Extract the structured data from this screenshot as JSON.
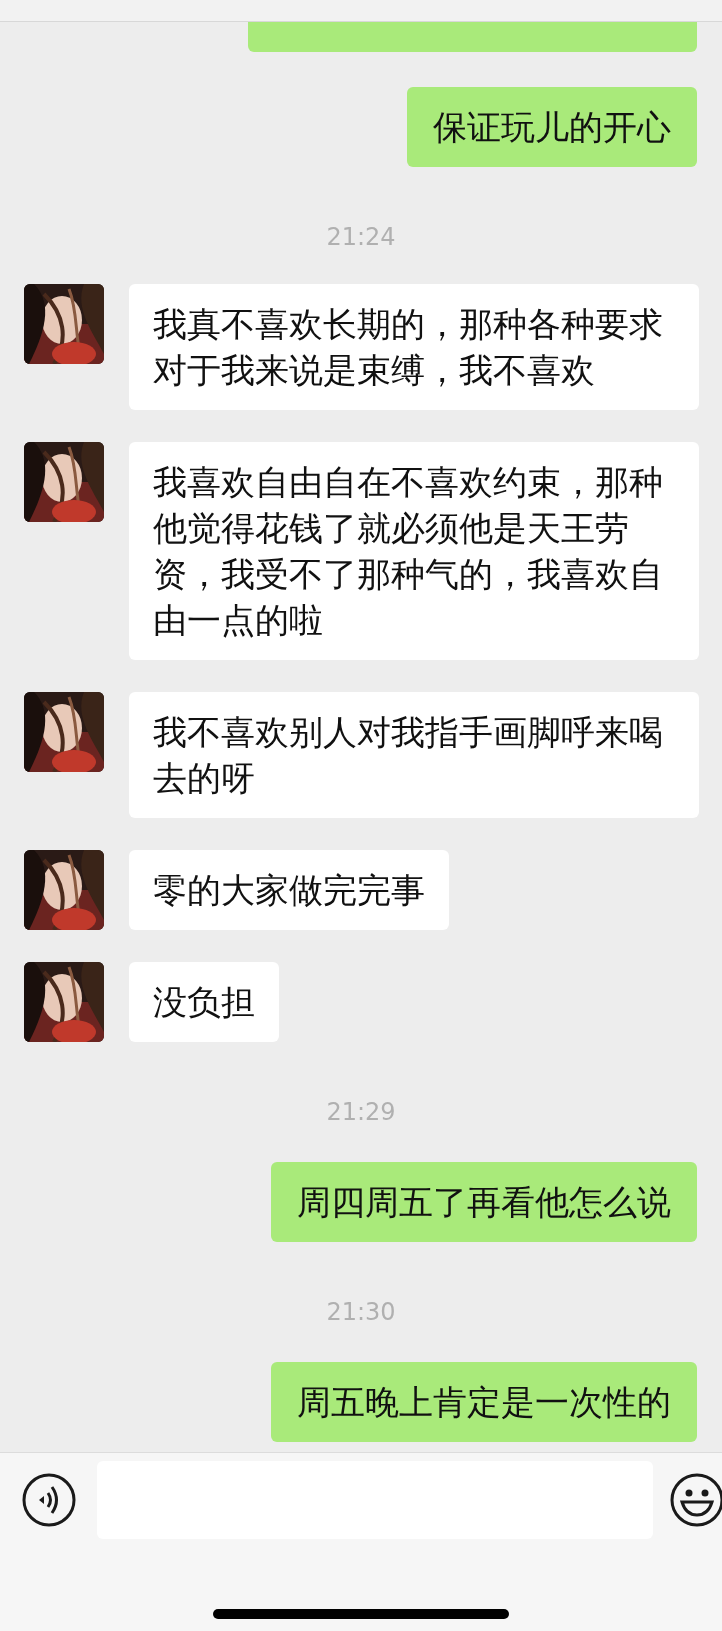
{
  "messages": [
    {
      "kind": "sent_clipped"
    },
    {
      "kind": "sent",
      "text": "保证玩儿的开心"
    },
    {
      "kind": "time",
      "text": "21:24"
    },
    {
      "kind": "received",
      "text": "我真不喜欢长期的，那种各种要求对于我来说是束缚，我不喜欢"
    },
    {
      "kind": "received",
      "text": "我喜欢自由自在不喜欢约束，那种他觉得花钱了就必须他是天王劳资，我受不了那种气的，我喜欢自由一点的啦"
    },
    {
      "kind": "received",
      "text": "我不喜欢别人对我指手画脚呼来喝去的呀"
    },
    {
      "kind": "received",
      "text": "零的大家做完完事"
    },
    {
      "kind": "received",
      "text": "没负担"
    },
    {
      "kind": "time",
      "text": "21:29"
    },
    {
      "kind": "sent",
      "text": "周四周五了再看他怎么说"
    },
    {
      "kind": "time",
      "text": "21:30"
    },
    {
      "kind": "sent",
      "text": "周五晚上肯定是一次性的"
    }
  ]
}
